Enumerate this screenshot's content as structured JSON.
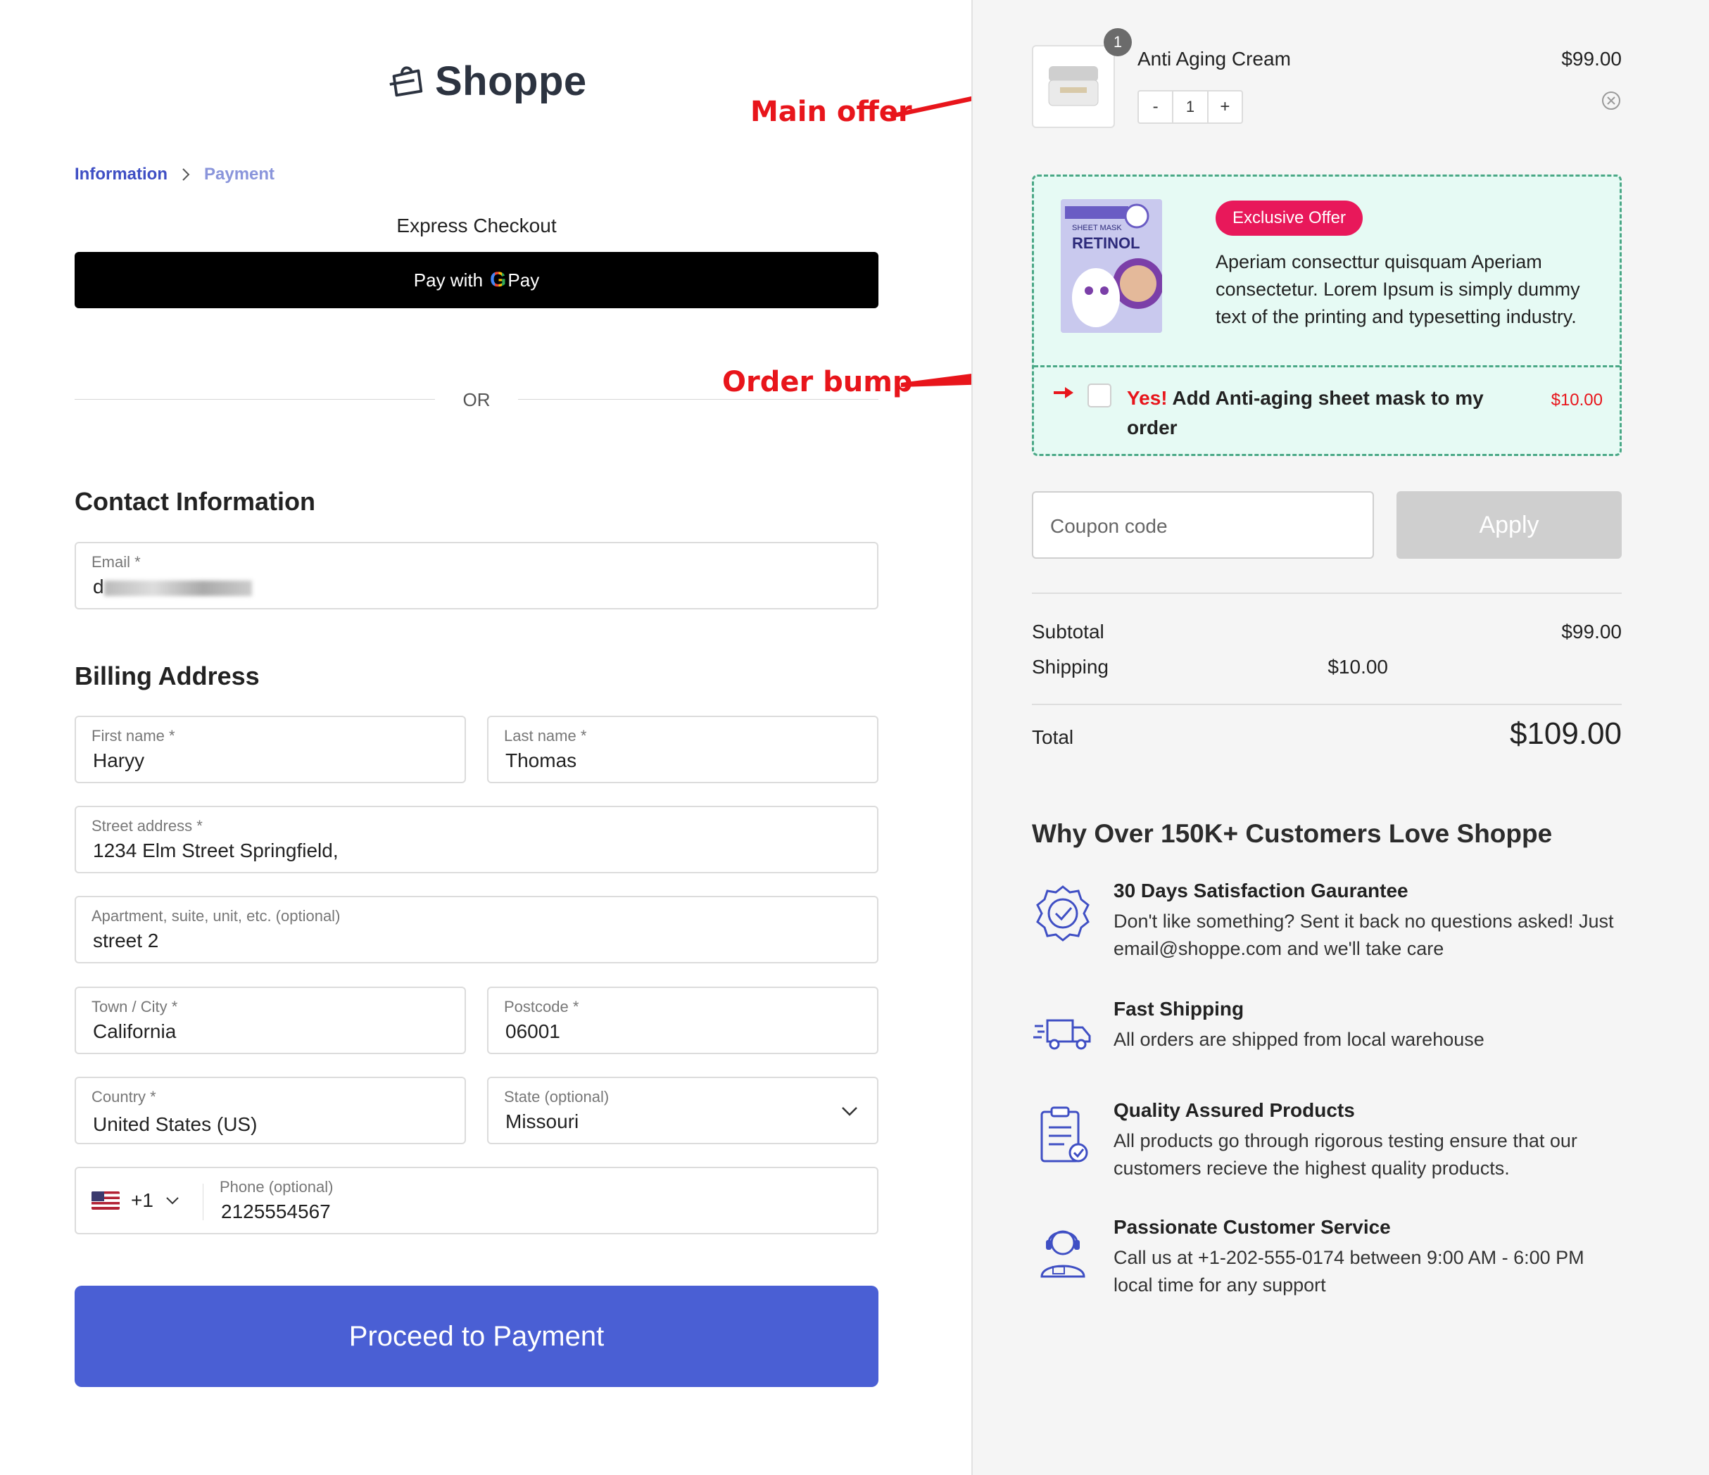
{
  "brand": {
    "name": "Shoppe"
  },
  "breadcrumb": {
    "active": "Information",
    "next": "Payment"
  },
  "express": {
    "title": "Express Checkout",
    "gpay_prefix": "Pay with",
    "gpay_g": "G",
    "gpay_suffix": "Pay"
  },
  "divider": {
    "or": "OR"
  },
  "contact": {
    "title": "Contact Information",
    "email_label": "Email *",
    "email_value_visible": "d"
  },
  "billing": {
    "title": "Billing Address",
    "first_name_label": "First name *",
    "first_name": "Haryy",
    "last_name_label": "Last name *",
    "last_name": "Thomas",
    "street_label": "Street address *",
    "street": "1234 Elm Street Springfield,",
    "apt_label": "Apartment, suite, unit, etc. (optional)",
    "apt": "street 2",
    "city_label": "Town / City *",
    "city": "California",
    "postcode_label": "Postcode *",
    "postcode": "06001",
    "country_label": "Country *",
    "country": "United States (US)",
    "state_label": "State (optional)",
    "state": "Missouri",
    "phone_label": "Phone (optional)",
    "phone_code": "+1",
    "phone": "2125554567"
  },
  "proceed_label": "Proceed to Payment",
  "annotations": {
    "main_offer": "Main offer",
    "order_bump": "Order bump"
  },
  "cart": {
    "item_name": "Anti Aging Cream",
    "item_price": "$99.00",
    "item_qty_badge": "1",
    "qty_minus": "-",
    "qty_value": "1",
    "qty_plus": "+"
  },
  "bump": {
    "badge": "Exclusive Offer",
    "text": "Aperiam consecttur quisquam Aperiam consectetur. Lorem Ipsum is simply dummy text of the printing and typesetting industry.",
    "yes": "Yes!",
    "offer": "Add Anti-aging sheet mask to my order",
    "price": "$10.00",
    "img_text_1": "SHEET MASK",
    "img_text_2": "RETINOL"
  },
  "coupon": {
    "placeholder": "Coupon code",
    "apply": "Apply"
  },
  "summary": {
    "subtotal_label": "Subtotal",
    "subtotal": "$99.00",
    "shipping_label": "Shipping",
    "shipping": "$10.00",
    "total_label": "Total",
    "total": "$109.00"
  },
  "why": {
    "title": "Why Over 150K+ Customers Love Shoppe",
    "features": [
      {
        "title": "30 Days Satisfaction Gaurantee",
        "desc": "Don't like something? Sent it back no questions asked! Just email@shoppe.com and we'll take care",
        "icon": "badge-check-icon"
      },
      {
        "title": "Fast Shipping",
        "desc": "All orders are shipped from local warehouse",
        "icon": "truck-icon"
      },
      {
        "title": "Quality Assured Products",
        "desc": "All products go through rigorous testing ensure that our customers recieve the highest quality products.",
        "icon": "clipboard-check-icon"
      },
      {
        "title": "Passionate Customer Service",
        "desc": "Call us at +1-202-555-0174 between 9:00 AM - 6:00 PM local time for any support",
        "icon": "headset-agent-icon"
      }
    ]
  },
  "colors": {
    "accent": "#4a5fd4",
    "annotation": "#e8151b",
    "bump_border": "#4aa886",
    "badge": "#e8185a"
  }
}
